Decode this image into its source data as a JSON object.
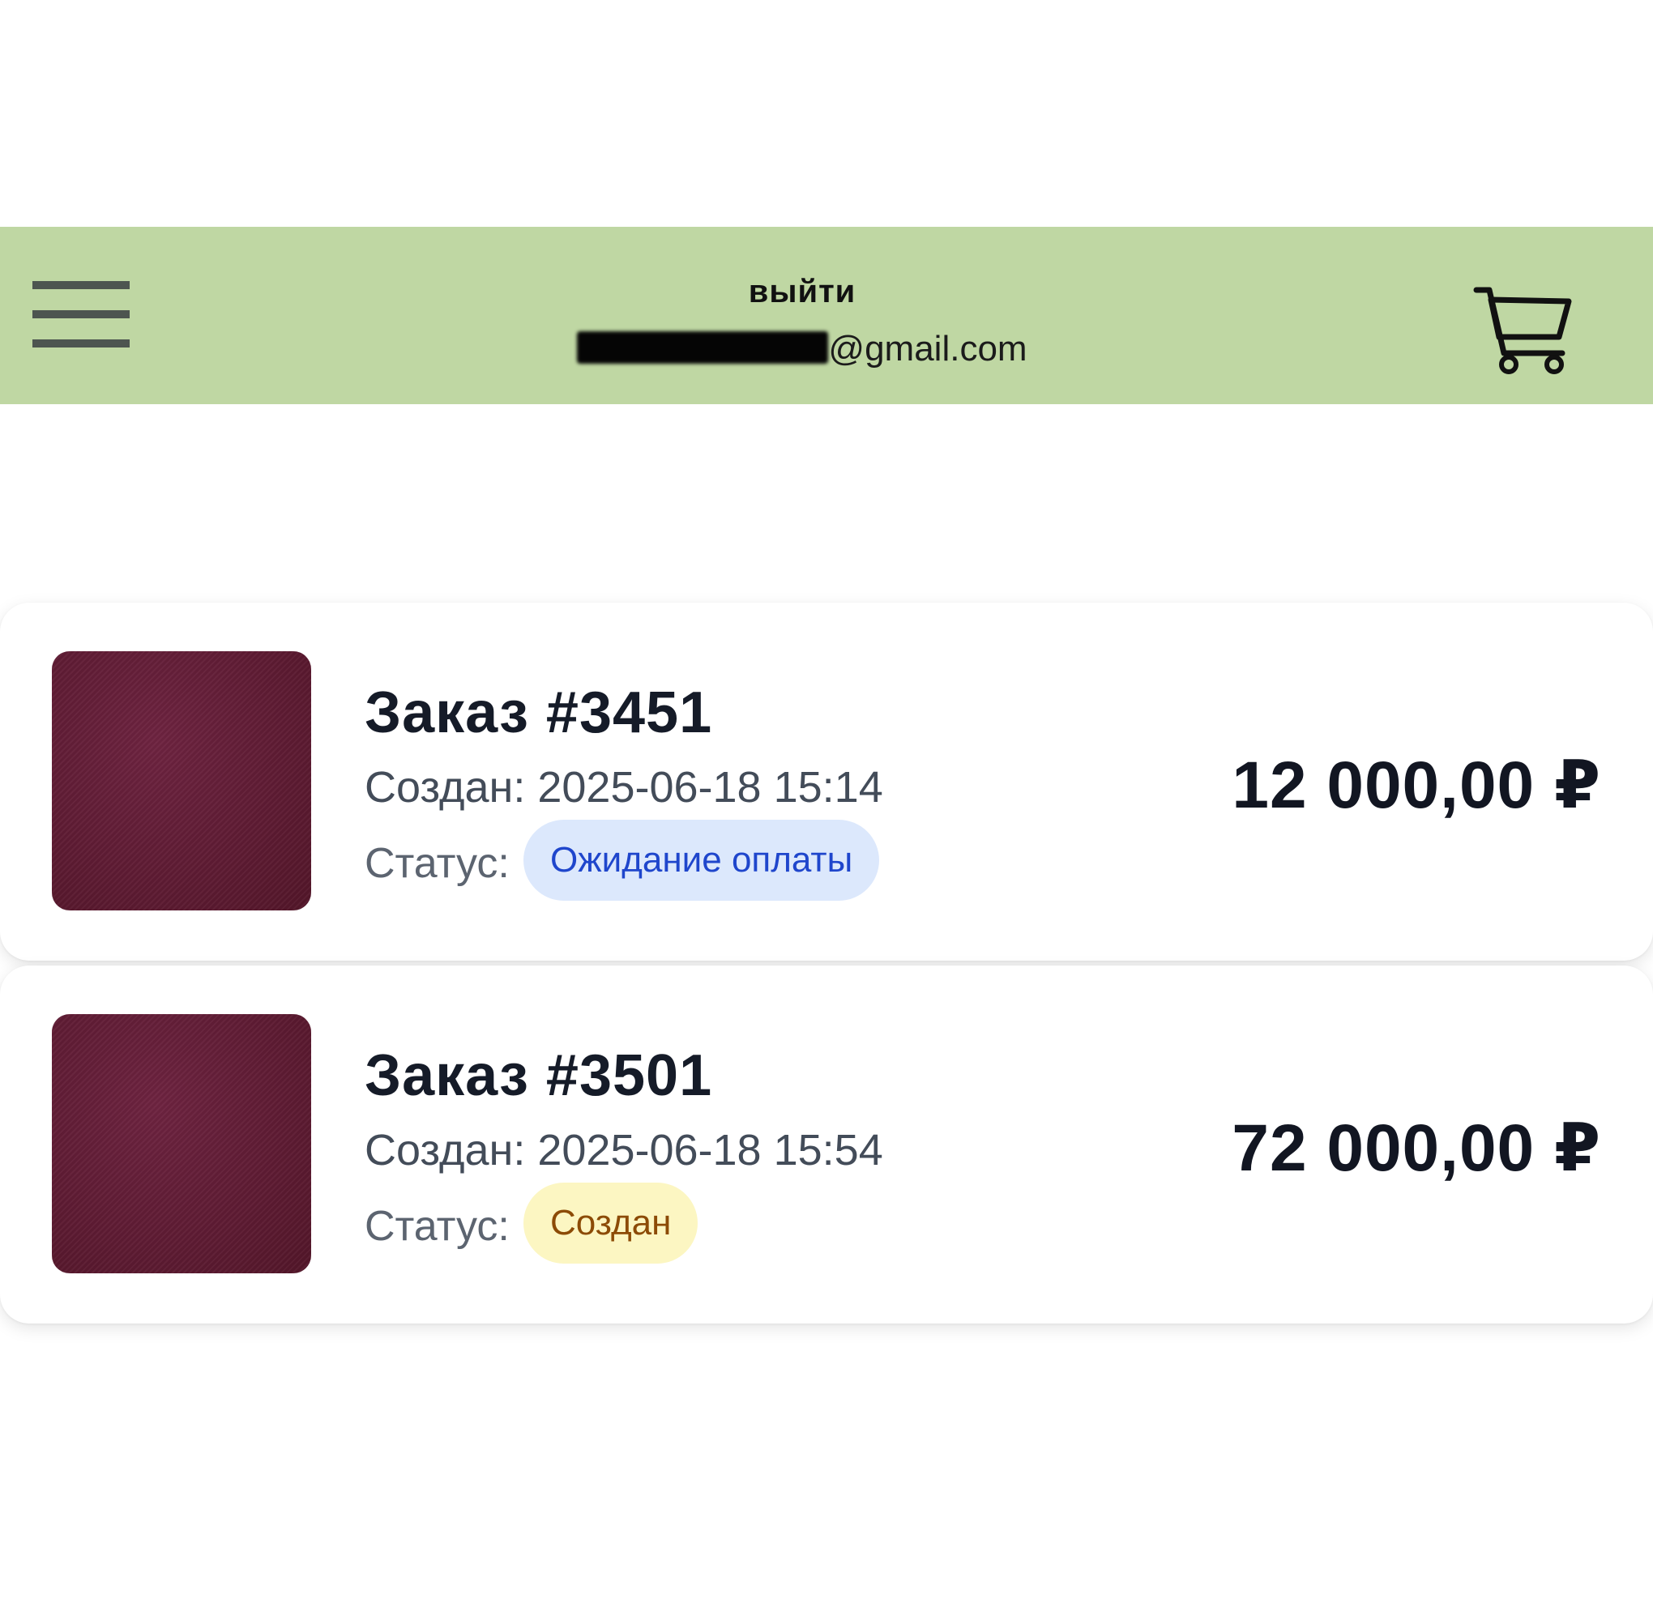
{
  "header": {
    "logout_label": "выйти",
    "email_visible_suffix": "@gmail.com",
    "background": "#bfd7a3",
    "menu_icon": "hamburger-menu-icon",
    "cart_icon": "shopping-cart-icon"
  },
  "orders": [
    {
      "title": "Заказ #3451",
      "created": "Создан: 2025-06-18 15:14",
      "status_label": "Статус:",
      "status": "Ожидание оплаты",
      "status_colors": {
        "bg": "#dce8fc",
        "fg": "#1f46cc"
      },
      "price": "12 000,00 ₽"
    },
    {
      "title": "Заказ #3501",
      "created": "Создан: 2025-06-18 15:54",
      "status_label": "Статус:",
      "status": "Создан",
      "status_colors": {
        "bg": "#fcf6c2",
        "fg": "#8c4b06"
      },
      "price": "72 000,00 ₽"
    }
  ]
}
